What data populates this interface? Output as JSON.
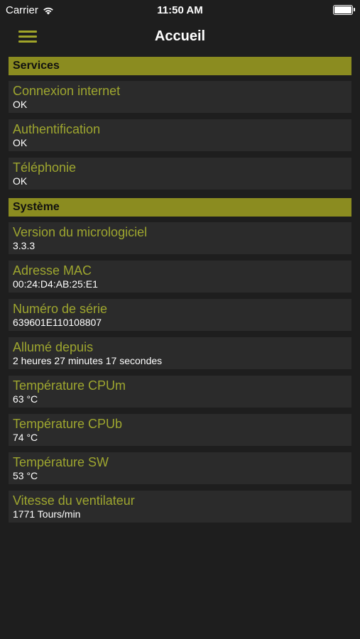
{
  "status_bar": {
    "carrier": "Carrier",
    "time": "11:50 AM"
  },
  "nav": {
    "title": "Accueil"
  },
  "sections": {
    "services": {
      "title": "Services",
      "items": [
        {
          "label": "Connexion internet",
          "value": "OK"
        },
        {
          "label": "Authentification",
          "value": "OK"
        },
        {
          "label": "Téléphonie",
          "value": "OK"
        }
      ]
    },
    "systeme": {
      "title": "Système",
      "items": [
        {
          "label": "Version du micrologiciel",
          "value": "3.3.3"
        },
        {
          "label": "Adresse MAC",
          "value": "00:24:D4:AB:25:E1"
        },
        {
          "label": "Numéro de série",
          "value": "639601E110108807"
        },
        {
          "label": "Allumé depuis",
          "value": "2 heures 27 minutes 17 secondes"
        },
        {
          "label": "Température CPUm",
          "value": "63 °C"
        },
        {
          "label": "Température CPUb",
          "value": "74 °C"
        },
        {
          "label": "Température SW",
          "value": "53 °C"
        },
        {
          "label": "Vitesse du ventilateur",
          "value": "1771 Tours/min"
        }
      ]
    }
  },
  "colors": {
    "accent": "#9ea62f",
    "section_bg": "#8b8c20",
    "cell_bg": "#2b2b2b",
    "background": "#1e1e1e"
  }
}
